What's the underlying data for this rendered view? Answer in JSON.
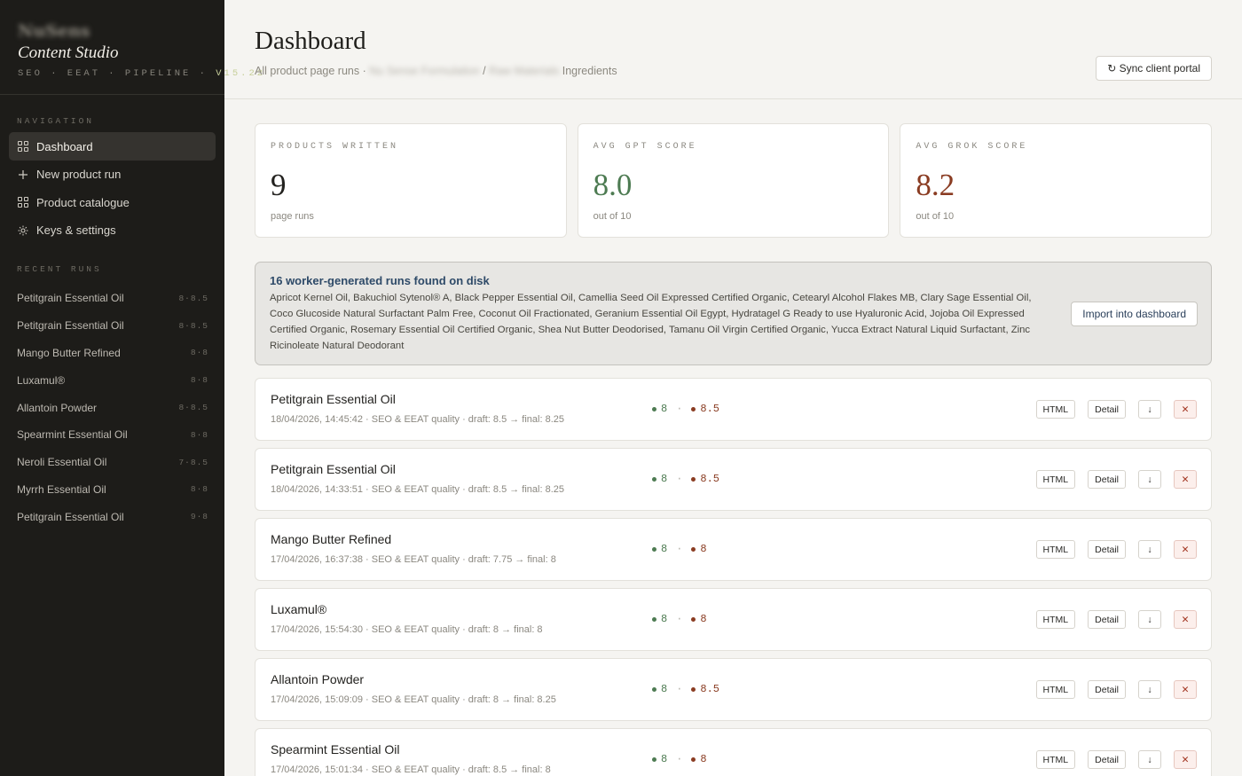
{
  "sidebar": {
    "brand_logo": "NuSense",
    "brand_name": "Content Studio",
    "brand_tag": "SEO · EEAT · PIPELINE · ",
    "brand_version": "V15.22",
    "nav_heading": "NAVIGATION",
    "nav": [
      {
        "label": "Dashboard",
        "icon": "grid-icon",
        "active": true
      },
      {
        "label": "New product run",
        "icon": "plus-icon",
        "active": false
      },
      {
        "label": "Product catalogue",
        "icon": "grid-icon",
        "active": false
      },
      {
        "label": "Keys & settings",
        "icon": "gear-icon",
        "active": false
      }
    ],
    "recent_heading": "RECENT RUNS",
    "recent": [
      {
        "name": "Petitgrain Essential Oil",
        "score": "8·8.5"
      },
      {
        "name": "Petitgrain Essential Oil",
        "score": "8·8.5"
      },
      {
        "name": "Mango Butter Refined",
        "score": "8·8"
      },
      {
        "name": "Luxamul®",
        "score": "8·8"
      },
      {
        "name": "Allantoin Powder",
        "score": "8·8.5"
      },
      {
        "name": "Spearmint Essential Oil",
        "score": "8·8"
      },
      {
        "name": "Neroli Essential Oil",
        "score": "7·8.5"
      },
      {
        "name": "Myrrh Essential Oil",
        "score": "8·8"
      },
      {
        "name": "Petitgrain Essential Oil",
        "score": "9·8"
      }
    ]
  },
  "header": {
    "title": "Dashboard",
    "crumb_prefix": "All product page runs ·",
    "crumb_blur1": "Nu Sense Formulation",
    "crumb_sep": "/",
    "crumb_blur2": "Raw Materials",
    "crumb_last": "Ingredients",
    "sync_label": "↻ Sync client portal"
  },
  "stats": [
    {
      "label": "PRODUCTS WRITTEN",
      "value": "9",
      "sub": "page runs",
      "kind": "plain"
    },
    {
      "label": "AVG GPT SCORE",
      "value": "8.0",
      "sub": "out of 10",
      "kind": "gpt"
    },
    {
      "label": "AVG GROK SCORE",
      "value": "8.2",
      "sub": "out of 10",
      "kind": "grok"
    }
  ],
  "notice": {
    "title": "16 worker-generated runs found on disk",
    "text": "Apricot Kernel Oil, Bakuchiol Sytenol® A, Black Pepper Essential Oil, Camellia Seed Oil Expressed Certified Organic, Cetearyl Alcohol Flakes MB, Clary Sage Essential Oil, Coco Glucoside Natural Surfactant Palm Free, Coconut Oil Fractionated, Geranium Essential Oil Egypt, Hydratagel G Ready to use Hyaluronic Acid, Jojoba Oil Expressed Certified Organic, Rosemary Essential Oil Certified Organic, Shea Nut Butter Deodorised, Tamanu Oil Virgin Certified Organic, Yucca Extract Natural Liquid Surfactant, Zinc Ricinoleate Natural Deodorant",
    "button": "Import into dashboard"
  },
  "run_actions": {
    "html": "HTML",
    "detail": "Detail",
    "download": "↓",
    "delete": "✕"
  },
  "runs": [
    {
      "name": "Petitgrain Essential Oil",
      "meta": "18/04/2026, 14:45:42 · SEO & EEAT quality · draft: 8.5 → final: 8.25",
      "gpt": "8",
      "sep": "·",
      "grok": "8.5"
    },
    {
      "name": "Petitgrain Essential Oil",
      "meta": "18/04/2026, 14:33:51 · SEO & EEAT quality · draft: 8.5 → final: 8.25",
      "gpt": "8",
      "sep": "·",
      "grok": "8.5"
    },
    {
      "name": "Mango Butter Refined",
      "meta": "17/04/2026, 16:37:38 · SEO & EEAT quality · draft: 7.75 → final: 8",
      "gpt": "8",
      "sep": "·",
      "grok": "8"
    },
    {
      "name": "Luxamul®",
      "meta": "17/04/2026, 15:54:30 · SEO & EEAT quality · draft: 8 → final: 8",
      "gpt": "8",
      "sep": "·",
      "grok": "8"
    },
    {
      "name": "Allantoin Powder",
      "meta": "17/04/2026, 15:09:09 · SEO & EEAT quality · draft: 8 → final: 8.25",
      "gpt": "8",
      "sep": "·",
      "grok": "8.5"
    },
    {
      "name": "Spearmint Essential Oil",
      "meta": "17/04/2026, 15:01:34 · SEO & EEAT quality · draft: 8.5 → final: 8",
      "gpt": "8",
      "sep": "·",
      "grok": "8"
    }
  ]
}
